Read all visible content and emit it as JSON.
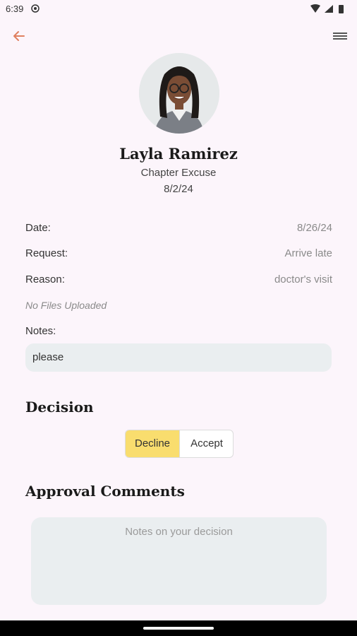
{
  "status": {
    "time": "6:39"
  },
  "profile": {
    "name": "Layla Ramirez",
    "type": "Chapter Excuse",
    "submitted": "8/2/24"
  },
  "details": [
    {
      "label": "Date:",
      "value": "8/26/24"
    },
    {
      "label": "Request:",
      "value": "Arrive late"
    },
    {
      "label": "Reason:",
      "value": "doctor's visit"
    }
  ],
  "files_text": "No Files Uploaded",
  "notes": {
    "label": "Notes:",
    "value": "please"
  },
  "decision": {
    "heading": "Decision",
    "decline_label": "Decline",
    "accept_label": "Accept",
    "selected": "Decline"
  },
  "approval": {
    "heading": "Approval Comments",
    "placeholder": "Notes on your decision"
  },
  "colors": {
    "accent": "#e08060",
    "selected": "#f9dd6e",
    "background": "#fcf5fb",
    "field": "#eaeef0"
  },
  "icons": {
    "back": "arrow-left-icon",
    "menu": "menu-icon"
  }
}
